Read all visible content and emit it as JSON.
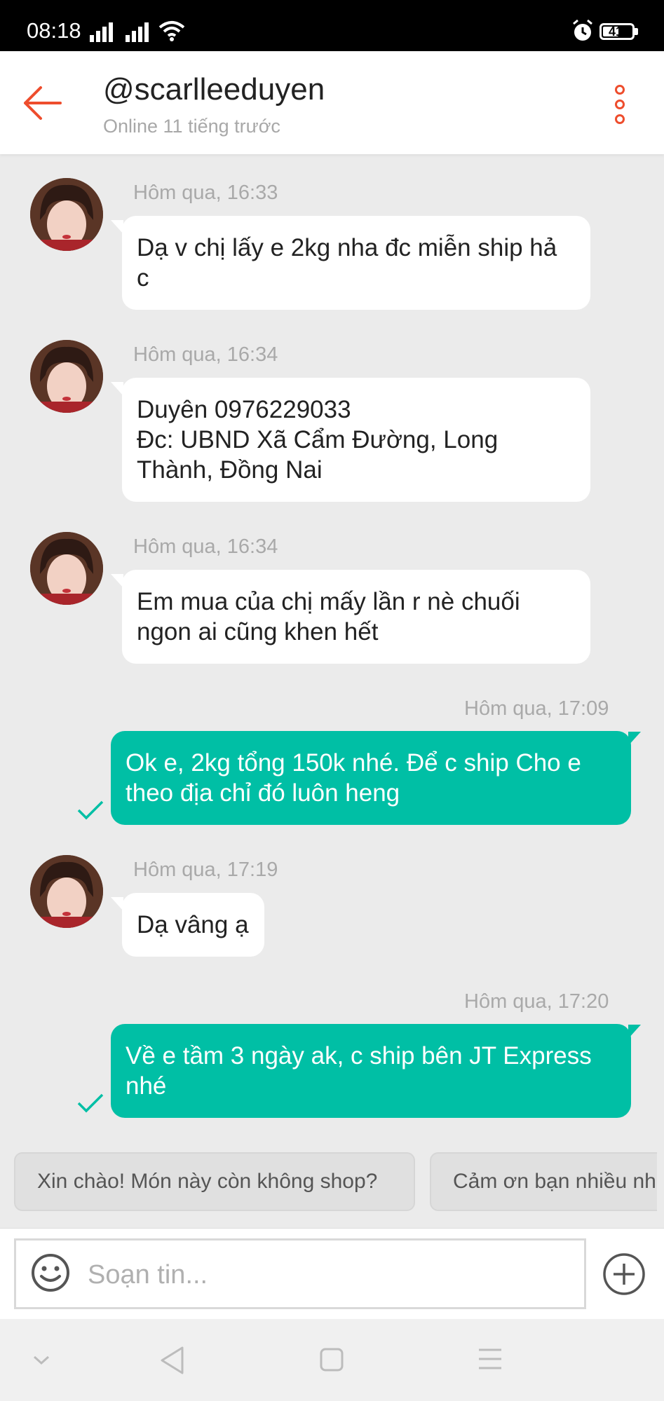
{
  "status_bar": {
    "time": "08:18",
    "battery": "41"
  },
  "header": {
    "username": "@scarlleeduyen",
    "status": "Online 11 tiếng trước"
  },
  "messages": [
    {
      "direction": "in",
      "time": "Hôm qua, 16:33",
      "text": "Dạ v chị lấy e 2kg nha đc miễn ship hả c"
    },
    {
      "direction": "in",
      "time": "Hôm qua, 16:34",
      "text": "Duyên 0976229033\nĐc: UBND Xã Cẩm Đường, Long Thành, Đồng Nai"
    },
    {
      "direction": "in",
      "time": "Hôm qua, 16:34",
      "text": "Em mua của chị mấy lần r nè chuối ngon ai cũng khen hết"
    },
    {
      "direction": "out",
      "time": "Hôm qua, 17:09",
      "text": "Ok e, 2kg tổng 150k nhé. Để c ship Cho e theo địa chỉ đó luôn heng"
    },
    {
      "direction": "in",
      "time": "Hôm qua, 17:19",
      "text": "Dạ vâng ạ"
    },
    {
      "direction": "out",
      "time": "Hôm qua, 17:20",
      "text": "Về e tầm 3 ngày ak, c ship bên JT Express nhé"
    }
  ],
  "quick_replies": [
    "Xin chào! Món này còn không shop?",
    "Cảm ơn bạn nhiều nh"
  ],
  "compose": {
    "placeholder": "Soạn tin..."
  },
  "colors": {
    "accent": "#ee4d2d",
    "outgoing_bubble": "#00bfa5",
    "background": "#ebebeb"
  },
  "icons": {
    "back": "arrow-left-icon",
    "more": "more-vertical-icon",
    "emoji": "smiley-icon",
    "attach": "plus-circle-icon",
    "sent": "check-icon"
  }
}
